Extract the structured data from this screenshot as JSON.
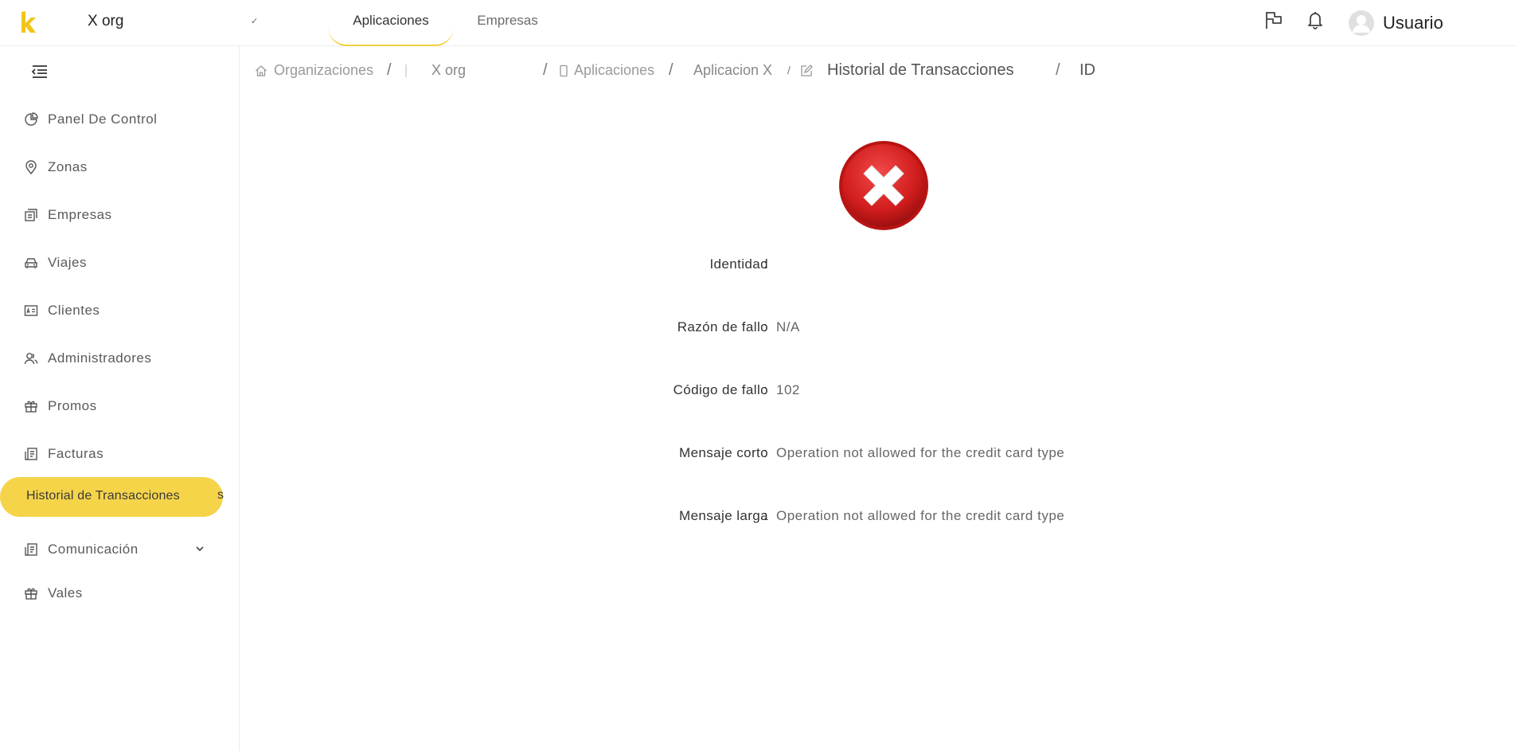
{
  "colors": {
    "accent": "#f5d44a",
    "error": "#d01c1c"
  },
  "header": {
    "logo_icon": "k-logo-icon",
    "org_name": "X org",
    "tabs": [
      {
        "label": "Aplicaciones",
        "active": true
      },
      {
        "label": "Empresas",
        "active": false
      }
    ],
    "icons": [
      "flag-icon",
      "bell-icon"
    ],
    "user_name": "Usuario"
  },
  "sidebar": {
    "collapse_icon": "menu-collapse-icon",
    "items": [
      {
        "label": "Panel De Control",
        "icon": "pie-chart-icon"
      },
      {
        "label": "Zonas",
        "icon": "map-pin-icon"
      },
      {
        "label": "Empresas",
        "icon": "building-icon"
      },
      {
        "label": "Viajes",
        "icon": "car-icon"
      },
      {
        "label": "Clientes",
        "icon": "id-card-icon"
      },
      {
        "label": "Administradores",
        "icon": "users-icon"
      },
      {
        "label": "Promos",
        "icon": "gift-icon"
      },
      {
        "label": "Facturas",
        "icon": "invoice-icon"
      },
      {
        "label": "Historial de Transacciones",
        "icon": "",
        "active": true,
        "tail": "s"
      },
      {
        "label": "Comunicación",
        "icon": "invoice-icon",
        "expandable": true
      },
      {
        "label": "Vales",
        "icon": "gift-icon"
      }
    ]
  },
  "breadcrumb": {
    "organizations": "Organizaciones",
    "org": "X org",
    "applications": "Aplicaciones",
    "app": "Aplicacion X",
    "partial_sep": "/",
    "page": "Historial de Transacciones",
    "id": "ID",
    "sep": "/"
  },
  "detail": {
    "status_icon": "error-x-icon",
    "rows": [
      {
        "label": "Identidad",
        "value": ""
      },
      {
        "label": "Razón de fallo",
        "value": "N/A"
      },
      {
        "label": "Código de fallo",
        "value": "102"
      },
      {
        "label": "Mensaje corto",
        "value": "Operation not allowed for the credit card type"
      },
      {
        "label": "Mensaje larga",
        "value": "Operation not allowed for the credit card type"
      }
    ],
    "colon": ":"
  }
}
